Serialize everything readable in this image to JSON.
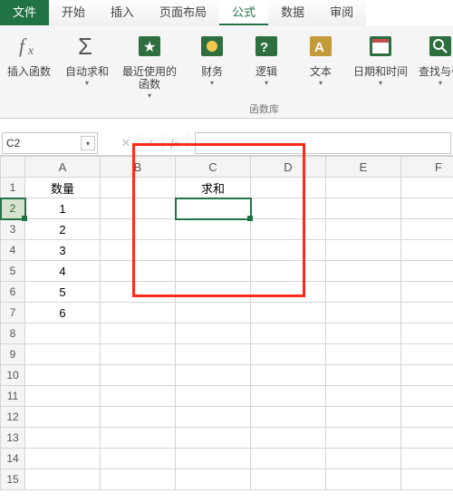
{
  "tabs": {
    "file": "文件",
    "home": "开始",
    "insert": "插入",
    "layout": "页面布局",
    "formulas": "公式",
    "data": "数据",
    "review": "审阅"
  },
  "ribbon": {
    "insert_fn": "插入函数",
    "autosum": "自动求和",
    "recent": "最近使用的\n函数",
    "financial": "财务",
    "logical": "逻辑",
    "text": "文本",
    "datetime": "日期和时间",
    "lookup": "查找与引",
    "group_fn": "函数库"
  },
  "namebox": {
    "value": "C2"
  },
  "fbar": {
    "fx": "fx"
  },
  "columns": [
    "A",
    "B",
    "C",
    "D",
    "E",
    "F"
  ],
  "rows": [
    "1",
    "2",
    "3",
    "4",
    "5",
    "6",
    "7",
    "8",
    "9",
    "10",
    "11",
    "12",
    "13",
    "14",
    "15"
  ],
  "cells": {
    "A1": "数量",
    "C1": "求和",
    "A2": "1",
    "A3": "2",
    "A4": "3",
    "A5": "4",
    "A6": "5",
    "A7": "6"
  },
  "selected": "C2",
  "icons": {
    "fx": "fx",
    "sigma": "Σ",
    "cancel": "✕",
    "enter": "✓"
  }
}
